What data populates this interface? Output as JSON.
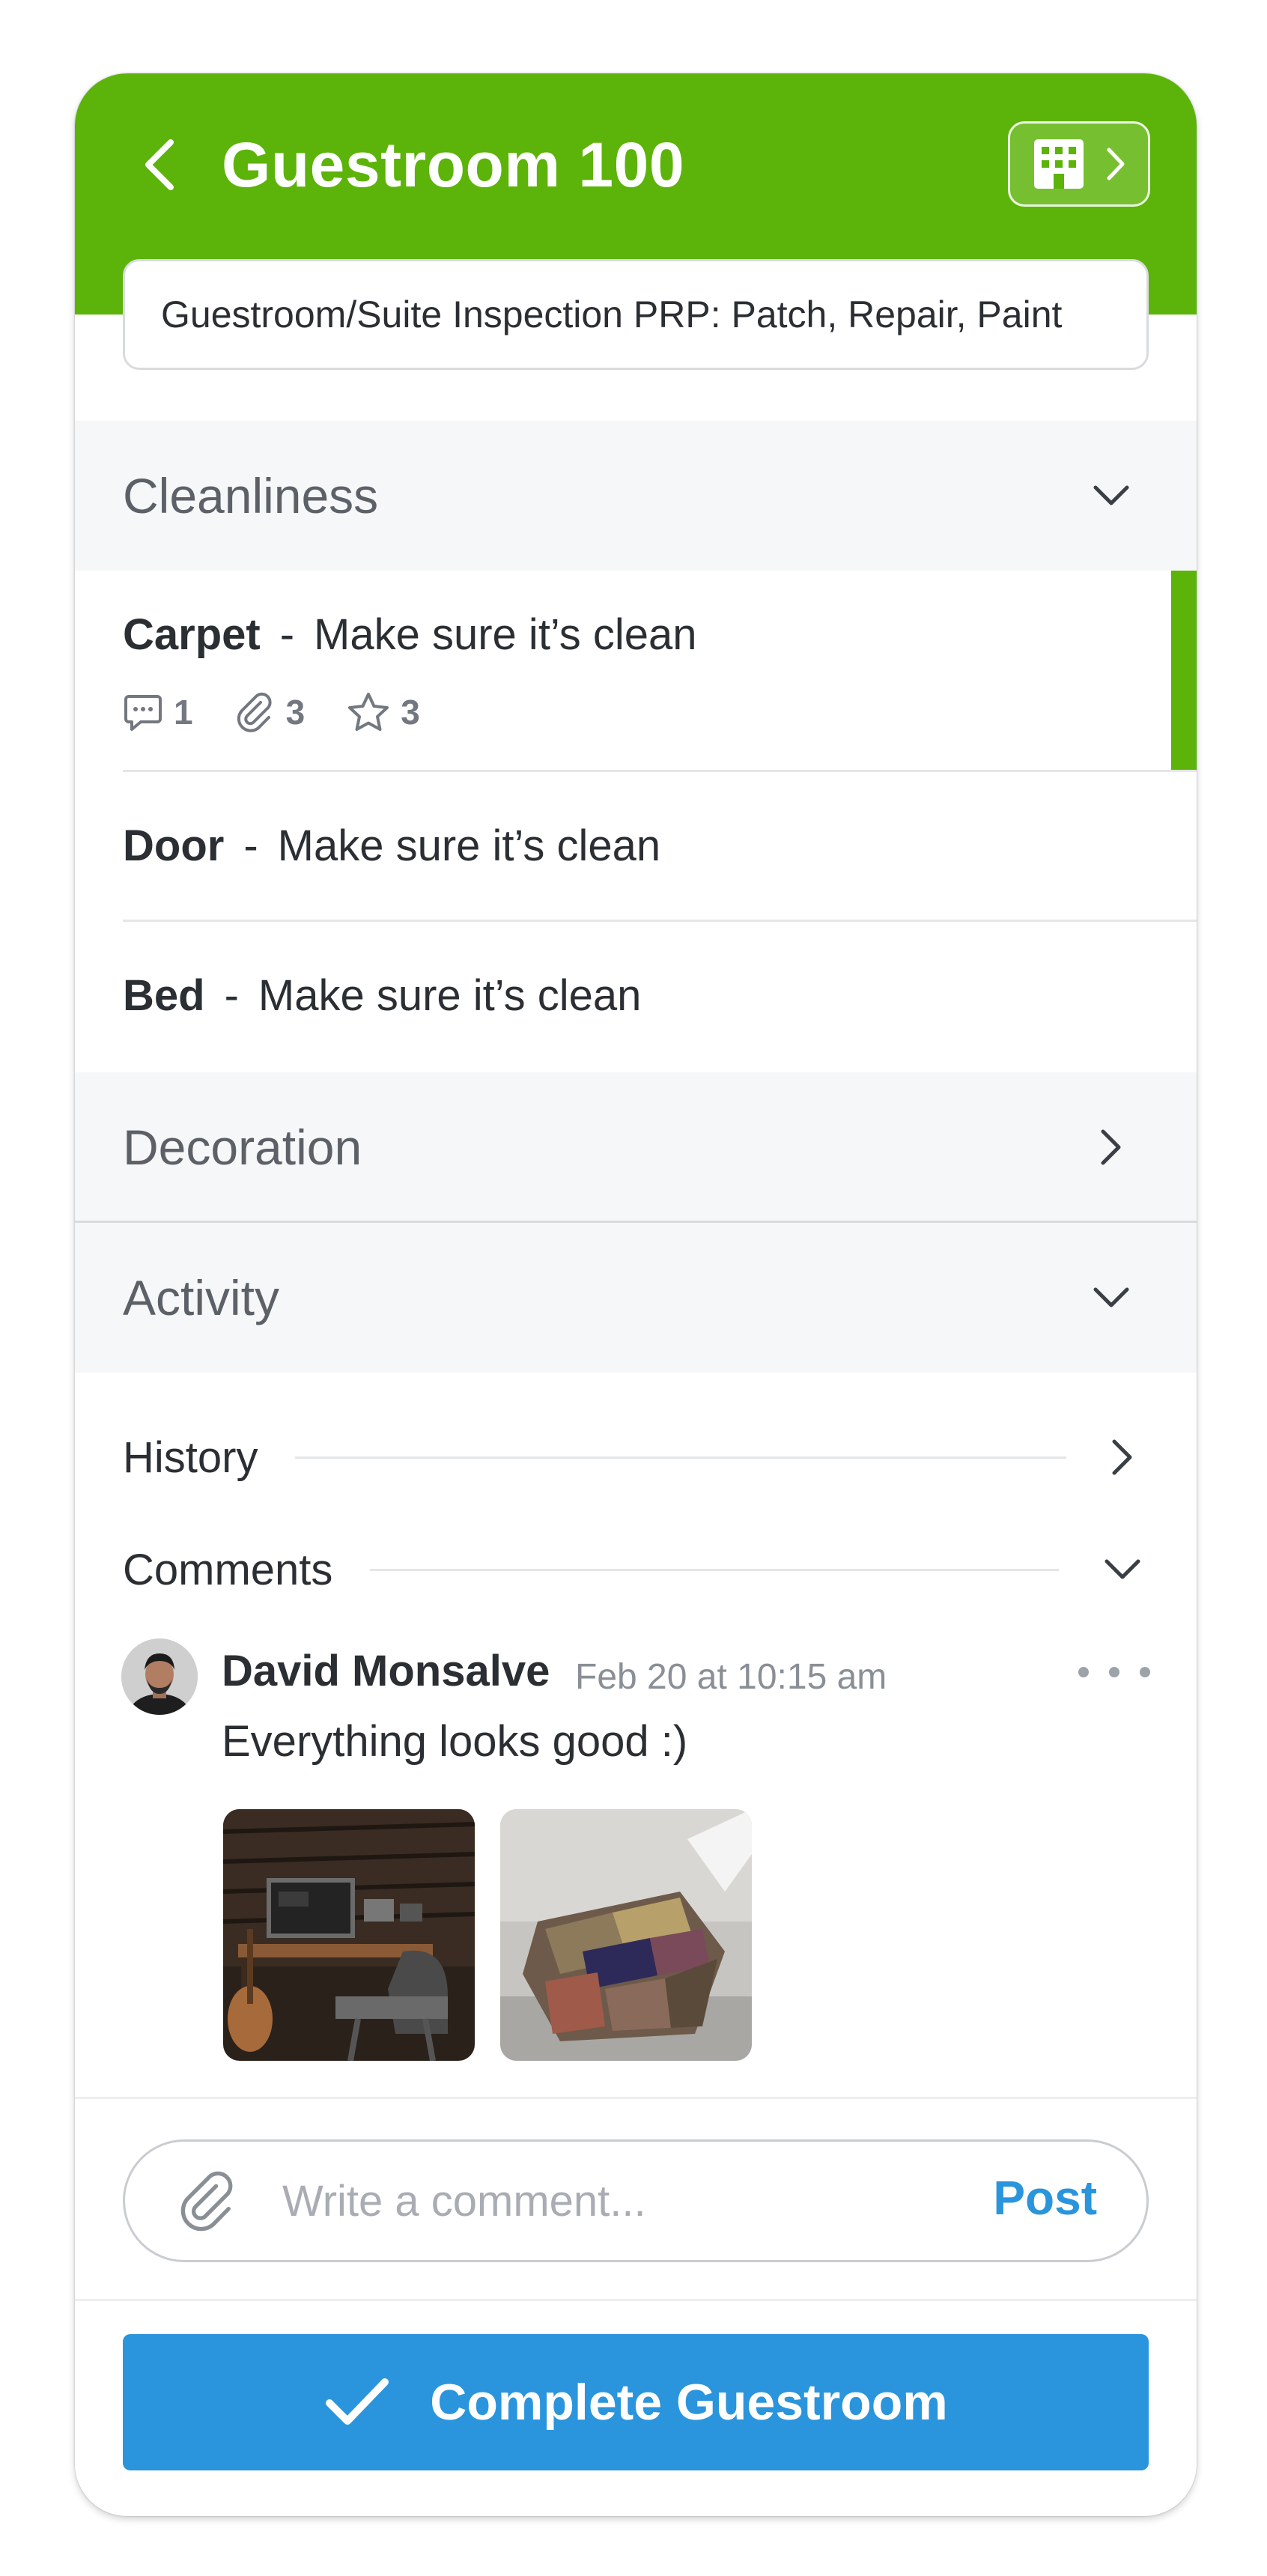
{
  "header": {
    "title": "Guestroom 100",
    "subtitle": "Guestroom/Suite Inspection PRP: Patch, Repair, Paint",
    "accent_color": "#5cb309",
    "building_icon": "building-icon"
  },
  "sections": {
    "cleanliness": {
      "title": "Cleanliness",
      "state": "expanded",
      "items": [
        {
          "name": "Carpet",
          "separator": "-",
          "description": "Make sure it’s clean",
          "comments": "1",
          "attachments": "3",
          "rating": "3",
          "active": true
        },
        {
          "name": "Door",
          "separator": "-",
          "description": "Make sure it’s clean"
        },
        {
          "name": "Bed",
          "separator": "-",
          "description": "Make sure it’s clean"
        }
      ]
    },
    "decoration": {
      "title": "Decoration",
      "state": "collapsed"
    },
    "activity": {
      "title": "Activity",
      "state": "expanded"
    }
  },
  "activity": {
    "history_label": "History",
    "comments_label": "Comments"
  },
  "comment": {
    "author": "David Monsalve",
    "timestamp": "Feb 20 at 10:15 am",
    "text": "Everything looks good :)",
    "attachments": [
      "studio-desk-photo",
      "modular-sofa-photo"
    ]
  },
  "composer": {
    "placeholder": "Write a comment...",
    "post_label": "Post"
  },
  "actions": {
    "complete_label": "Complete Guestroom",
    "button_color": "#2a95dc"
  }
}
